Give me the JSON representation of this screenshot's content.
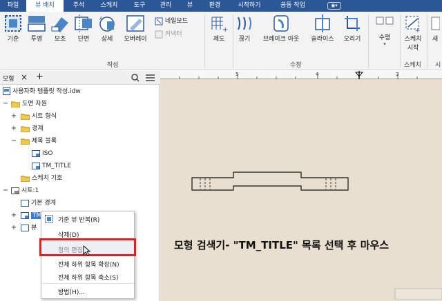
{
  "menu": {
    "tabs": [
      "파일",
      "뷰 배치",
      "주석",
      "스케치",
      "도구",
      "관리",
      "뷰",
      "환경",
      "시작하기",
      "공동 작업"
    ],
    "active_tab": 1,
    "accent": "#2b5797"
  },
  "ribbon": {
    "create_buttons": [
      "기준",
      "투영",
      "보조",
      "단면",
      "상세",
      "오버레이"
    ],
    "small_buttons": {
      "nailboard": "네일보드",
      "connector": "커넥터"
    },
    "create_group_label": "작성",
    "modify_buttons": [
      "제도",
      "끊기",
      "브레이크 아웃",
      "슬라이스",
      "오리기"
    ],
    "modify_group_label": "수정",
    "extra_buttons": {
      "horizontal": "수평",
      "sketch_start": "스케치",
      "sketch_start_line2": "시작"
    },
    "sketch_group_label": "스케치",
    "last_group_label": "시",
    "last_group_btn": "새"
  },
  "browser": {
    "tab_label": "모형",
    "root": "사용자화 템플릿 작성.idw",
    "nodes": {
      "drawing_resources": "도면 자원",
      "sheet_formats": "시트 형식",
      "borders": "경계",
      "title_blocks": "제목 블록",
      "iso": "ISO",
      "tm_title": "TM_TITLE",
      "sketch_symbols": "스케치 기호",
      "sheet1": "시트:1",
      "default_border": "기본 경계",
      "tm_short": "TM",
      "bu_short": "뷰"
    }
  },
  "context_menu": {
    "items": [
      "기준 뷰 반복(R)",
      "삭제(D)",
      "정의 편집",
      "전체 하위 항목 확장(N)",
      "전체 하위 항목 축소(S)",
      "방법(H)..."
    ],
    "highlighted_index": 2,
    "highlight_border": "#e02020"
  },
  "canvas": {
    "ruler_numbers": [
      "5",
      "4",
      "3"
    ],
    "caption": "모형 검색기- \"TM_TITLE\" 목록 선택 후 마우스",
    "background": "#e8dfd0"
  }
}
